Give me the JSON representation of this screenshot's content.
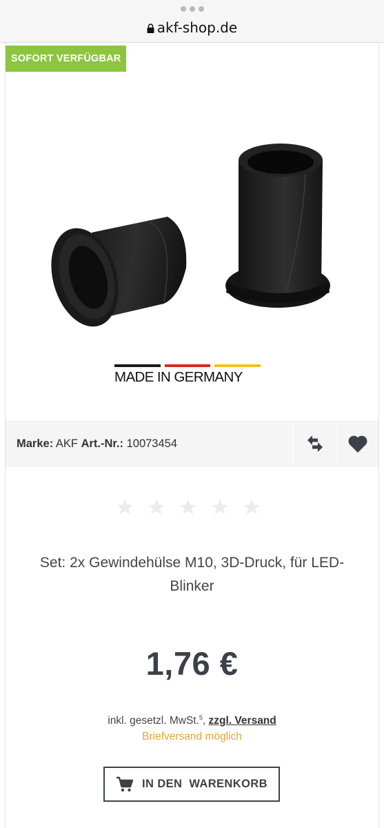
{
  "browser": {
    "url": "akf-shop.de"
  },
  "product": {
    "badge": "SOFORT VERFÜGBAR",
    "made_in": "MADE IN GERMANY",
    "brand_label": "Marke:",
    "brand": "AKF",
    "art_label": "Art.-Nr.:",
    "art_number": "10073454",
    "rating_stars": 5,
    "rating_value": 0,
    "title": "Set: 2x Gewindehülse M10, 3D-Druck, für LED-Blinker",
    "price": "1,76 €",
    "tax_text": "inkl. gesetzl. MwSt.",
    "tax_footnote": "5",
    "tax_sep": ",",
    "shipping_link": "zzgl. Versand",
    "delivery_note": "Briefversand möglich",
    "cart_button": "IN DEN  WARENKORB"
  },
  "icons": {
    "lock": "lock-icon",
    "compare": "compare-arrows-icon",
    "wishlist": "heart-icon",
    "cart": "shopping-cart-icon",
    "star": "star-icon",
    "menu": "more-dots-icon"
  },
  "colors": {
    "badge_bg": "#8cc63f",
    "delivery": "#e8a13a",
    "text_dark": "#3c4149",
    "star_empty": "#ececec",
    "flag_black": "#1a1a1a",
    "flag_red": "#d62b1e",
    "flag_gold": "#f2c31a"
  }
}
